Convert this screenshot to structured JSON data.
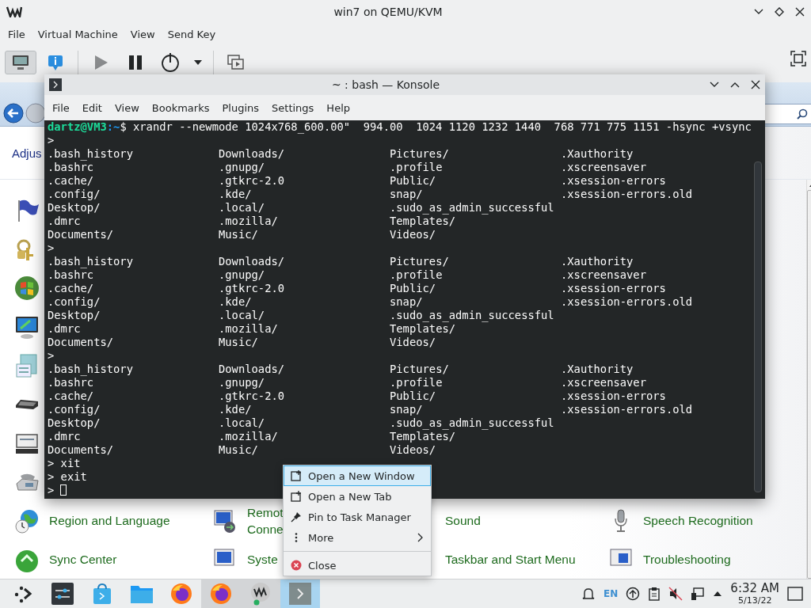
{
  "window": {
    "title": "win7 on QEMU/KVM"
  },
  "menu": [
    "File",
    "Virtual Machine",
    "View",
    "Send Key"
  ],
  "toolbar": [
    {
      "selected": true
    },
    {
      "selected": false
    },
    {
      "selected": false
    },
    {
      "selected": false
    },
    {
      "selected": false
    },
    {
      "selected": false
    },
    {
      "selected": false
    }
  ],
  "guest": {
    "heading": "Adjus",
    "items": [
      {
        "lines": [
          "Region and Language"
        ]
      },
      {
        "lines": [
          "Remot",
          "Conne"
        ]
      },
      {
        "lines": [
          "Sound"
        ]
      },
      {
        "lines": [
          "Speech Recognition"
        ]
      },
      {
        "lines": [
          "Sync Center"
        ]
      },
      {
        "lines": [
          "Syste"
        ]
      },
      {
        "lines": [
          "Taskbar and Start Menu"
        ]
      },
      {
        "lines": [
          "Troubleshooting"
        ]
      }
    ]
  },
  "konsole": {
    "title": "~ : bash — Konsole",
    "menu": [
      "File",
      "Edit",
      "View",
      "Bookmarks",
      "Plugins",
      "Settings",
      "Help"
    ],
    "lines": [
      {
        "kind": "prompt",
        "user": "dartz@VM3",
        "path": ":~",
        "symbol": "$",
        "command": "xrandr --newmode 1024x768_600.00\"  994.00  1024 1120 1232 1440  768 771 775 1151 -hsync +vsync"
      },
      {
        "kind": "text",
        "text": ">"
      },
      {
        "kind": "listing",
        "rows": [
          [
            ".bash_history",
            "Downloads/",
            "Pictures/",
            ".Xauthority"
          ],
          [
            ".bashrc",
            ".gnupg/",
            ".profile",
            ".xscreensaver"
          ],
          [
            ".cache/",
            ".gtkrc-2.0",
            "Public/",
            ".xsession-errors"
          ],
          [
            ".config/",
            ".kde/",
            "snap/",
            ".xsession-errors.old"
          ],
          [
            "Desktop/",
            ".local/",
            ".sudo_as_admin_successful"
          ],
          [
            ".dmrc",
            ".mozilla/",
            "Templates/"
          ],
          [
            "Documents/",
            "Music/",
            "Videos/"
          ]
        ]
      },
      {
        "kind": "text",
        "text": ">"
      },
      {
        "kind": "listing",
        "rows": [
          [
            ".bash_history",
            "Downloads/",
            "Pictures/",
            ".Xauthority"
          ],
          [
            ".bashrc",
            ".gnupg/",
            ".profile",
            ".xscreensaver"
          ],
          [
            ".cache/",
            ".gtkrc-2.0",
            "Public/",
            ".xsession-errors"
          ],
          [
            ".config/",
            ".kde/",
            "snap/",
            ".xsession-errors.old"
          ],
          [
            "Desktop/",
            ".local/",
            ".sudo_as_admin_successful"
          ],
          [
            ".dmrc",
            ".mozilla/",
            "Templates/"
          ],
          [
            "Documents/",
            "Music/",
            "Videos/"
          ]
        ]
      },
      {
        "kind": "text",
        "text": ">"
      },
      {
        "kind": "listing",
        "rows": [
          [
            ".bash_history",
            "Downloads/",
            "Pictures/",
            ".Xauthority"
          ],
          [
            ".bashrc",
            ".gnupg/",
            ".profile",
            ".xscreensaver"
          ],
          [
            ".cache/",
            ".gtkrc-2.0",
            "Public/",
            ".xsession-errors"
          ],
          [
            ".config/",
            ".kde/",
            "snap/",
            ".xsession-errors.old"
          ],
          [
            "Desktop/",
            ".local/",
            ".sudo_as_admin_successful"
          ],
          [
            ".dmrc",
            ".mozilla/",
            "Templates/"
          ],
          [
            "Documents/",
            "Music/",
            "Videos/"
          ]
        ]
      },
      {
        "kind": "text",
        "text": "> xit"
      },
      {
        "kind": "text",
        "text": "> exit"
      },
      {
        "kind": "cursor",
        "text": ">"
      }
    ]
  },
  "context_menu": [
    {
      "label": "Open a New Window",
      "selected": true,
      "submenu": false
    },
    {
      "label": "Open a New Tab",
      "selected": false,
      "submenu": false
    },
    {
      "label": "Pin to Task Manager",
      "selected": false,
      "submenu": false
    },
    {
      "label": "More",
      "selected": false,
      "submenu": true
    },
    {
      "label": "Close",
      "selected": false,
      "submenu": false
    }
  ],
  "taskbar": {
    "tasks": [
      {
        "running": false,
        "selected": false
      },
      {
        "running": false,
        "selected": false
      },
      {
        "running": false,
        "selected": false
      },
      {
        "running": false,
        "selected": false
      },
      {
        "running": false,
        "selected": false
      },
      {
        "running": true,
        "selected": false
      },
      {
        "running": true,
        "selected": false
      },
      {
        "running": true,
        "selected": true
      }
    ],
    "language": "EN",
    "time": "6:32 AM",
    "date": "5/13/22"
  }
}
